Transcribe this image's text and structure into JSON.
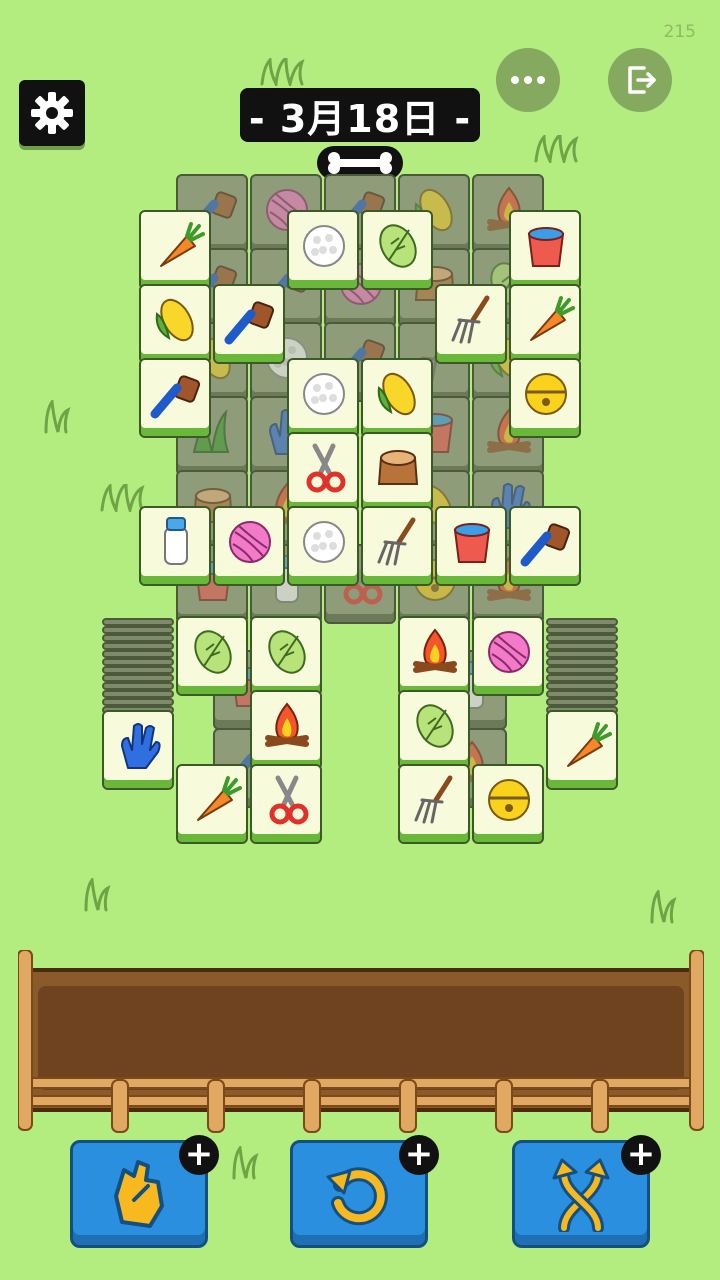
{
  "corner_counter": "215",
  "date_label": "- 3月18日 -",
  "icons": {
    "settings": "gear-icon",
    "more": "ellipsis-icon",
    "exit": "exit-icon",
    "bone": "bone-icon",
    "shuffle_pull": "hand-pull-icon",
    "undo": "undo-icon",
    "shuffle": "shuffle-arrows-icon"
  },
  "colors": {
    "background": "#b4ed7f",
    "tile_face": "#f7fbdc",
    "tile_base": "#69b83a",
    "button_blue": "#2b8fe0",
    "tray_wood": "#8b5a2b"
  },
  "tiles_top_layer": [
    "carrot",
    "rice-ball",
    "cabbage",
    "water-bucket",
    "corn",
    "blue-brush",
    "garden-fork",
    "carrot",
    "blue-brush",
    "rice-ball",
    "corn",
    "golden-bell",
    "pruning-shears",
    "tree-stump",
    "milk-bottle",
    "yarn-ball",
    "rice-ball",
    "garden-fork",
    "water-bucket",
    "blue-brush",
    "cabbage",
    "cabbage",
    "campfire",
    "yarn-ball",
    "blue-glove",
    "campfire",
    "cabbage",
    "carrot",
    "carrot",
    "pruning-shears",
    "garden-fork",
    "golden-bell"
  ],
  "tray_slots": 7,
  "boosters": [
    {
      "name": "pull",
      "plus": "+"
    },
    {
      "name": "undo",
      "plus": "+"
    },
    {
      "name": "shuffle",
      "plus": "+"
    }
  ]
}
